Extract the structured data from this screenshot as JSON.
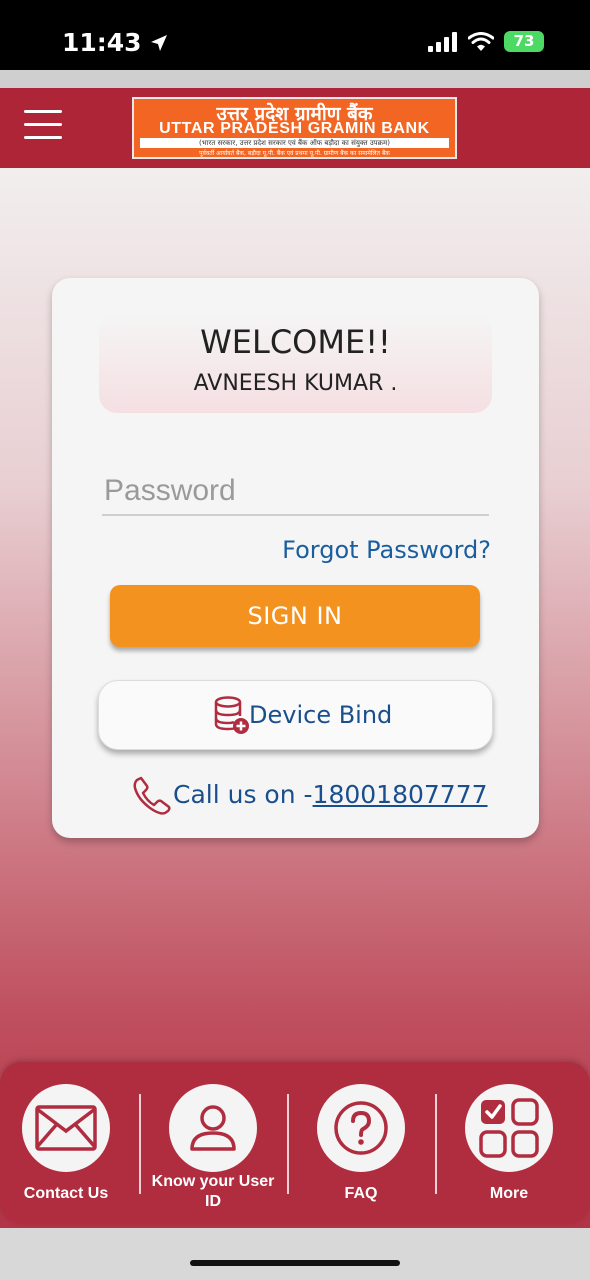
{
  "status_bar": {
    "time": "11:43",
    "battery": "73"
  },
  "header": {
    "logo_hindi": "उत्तर प्रदेश ग्रामीण बैंक",
    "logo_english": "UTTAR PRADESH GRAMIN BANK",
    "logo_subtitle": "(भारत सरकार, उत्तर प्रदेश सरकार एवं बैंक ऑफ बड़ौदा का संयुक्त उपक्रम)",
    "logo_tagline": "पूर्ववर्ती आर्यावर्त बैंक, बड़ौदा यू.पी. बैंक एवं प्रथमा यू.पी. ग्रामीण बैंक का समामेलित बैंक"
  },
  "login": {
    "welcome_title": "WELCOME!!",
    "user_name": "AVNEESH KUMAR .",
    "password_placeholder": "Password",
    "forgot_password": "Forgot Password?",
    "sign_in": "SIGN IN",
    "device_bind": "Device Bind",
    "call_prefix": "Call us on -",
    "call_number": "18001807777"
  },
  "bottom_nav": {
    "items": [
      {
        "label": "Contact Us",
        "icon": "envelope-icon"
      },
      {
        "label": "Know your User ID",
        "icon": "user-icon"
      },
      {
        "label": "FAQ",
        "icon": "question-icon"
      },
      {
        "label": "More",
        "icon": "grid-icon"
      }
    ]
  },
  "colors": {
    "brand": "#ad2537",
    "accent_orange": "#f3921f",
    "link_blue": "#1a5e9e"
  }
}
